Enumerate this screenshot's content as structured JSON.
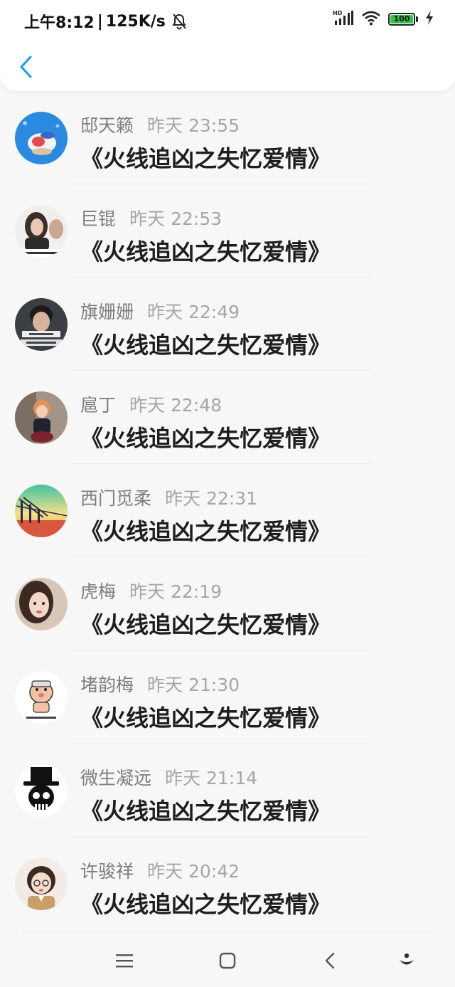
{
  "status_bar": {
    "time": "上午8:12",
    "separator": "|",
    "network_speed": "125K/s",
    "hd_label": "HD",
    "battery_level": "100",
    "icons": [
      "bell-muted-icon",
      "signal-icon",
      "wifi-icon",
      "battery-icon",
      "charging-icon"
    ],
    "battery_color": "#34c24a"
  },
  "nav": {
    "back_icon": "chevron-left-icon",
    "accent_color": "#2f9ee8"
  },
  "items": [
    {
      "name": "邸天籁",
      "time": "昨天 23:55",
      "title": "《火线追凶之失忆爱情》"
    },
    {
      "name": "巨锟",
      "time": "昨天 22:53",
      "title": "《火线追凶之失忆爱情》"
    },
    {
      "name": "旗姗姗",
      "time": "昨天 22:49",
      "title": "《火线追凶之失忆爱情》"
    },
    {
      "name": "扈丁",
      "time": "昨天 22:48",
      "title": "《火线追凶之失忆爱情》"
    },
    {
      "name": "西门觅柔",
      "time": "昨天 22:31",
      "title": "《火线追凶之失忆爱情》"
    },
    {
      "name": "虎梅",
      "time": "昨天 22:19",
      "title": "《火线追凶之失忆爱情》"
    },
    {
      "name": "堵韵梅",
      "time": "昨天 21:30",
      "title": "《火线追凶之失忆爱情》"
    },
    {
      "name": "微生凝远",
      "time": "昨天 21:14",
      "title": "《火线追凶之失忆爱情》"
    },
    {
      "name": "许骏祥",
      "time": "昨天 20:42",
      "title": "《火线追凶之失忆爱情》"
    }
  ],
  "system_nav": {
    "icons": [
      "menu-icon",
      "home-icon",
      "back-icon",
      "assistant-icon"
    ]
  }
}
